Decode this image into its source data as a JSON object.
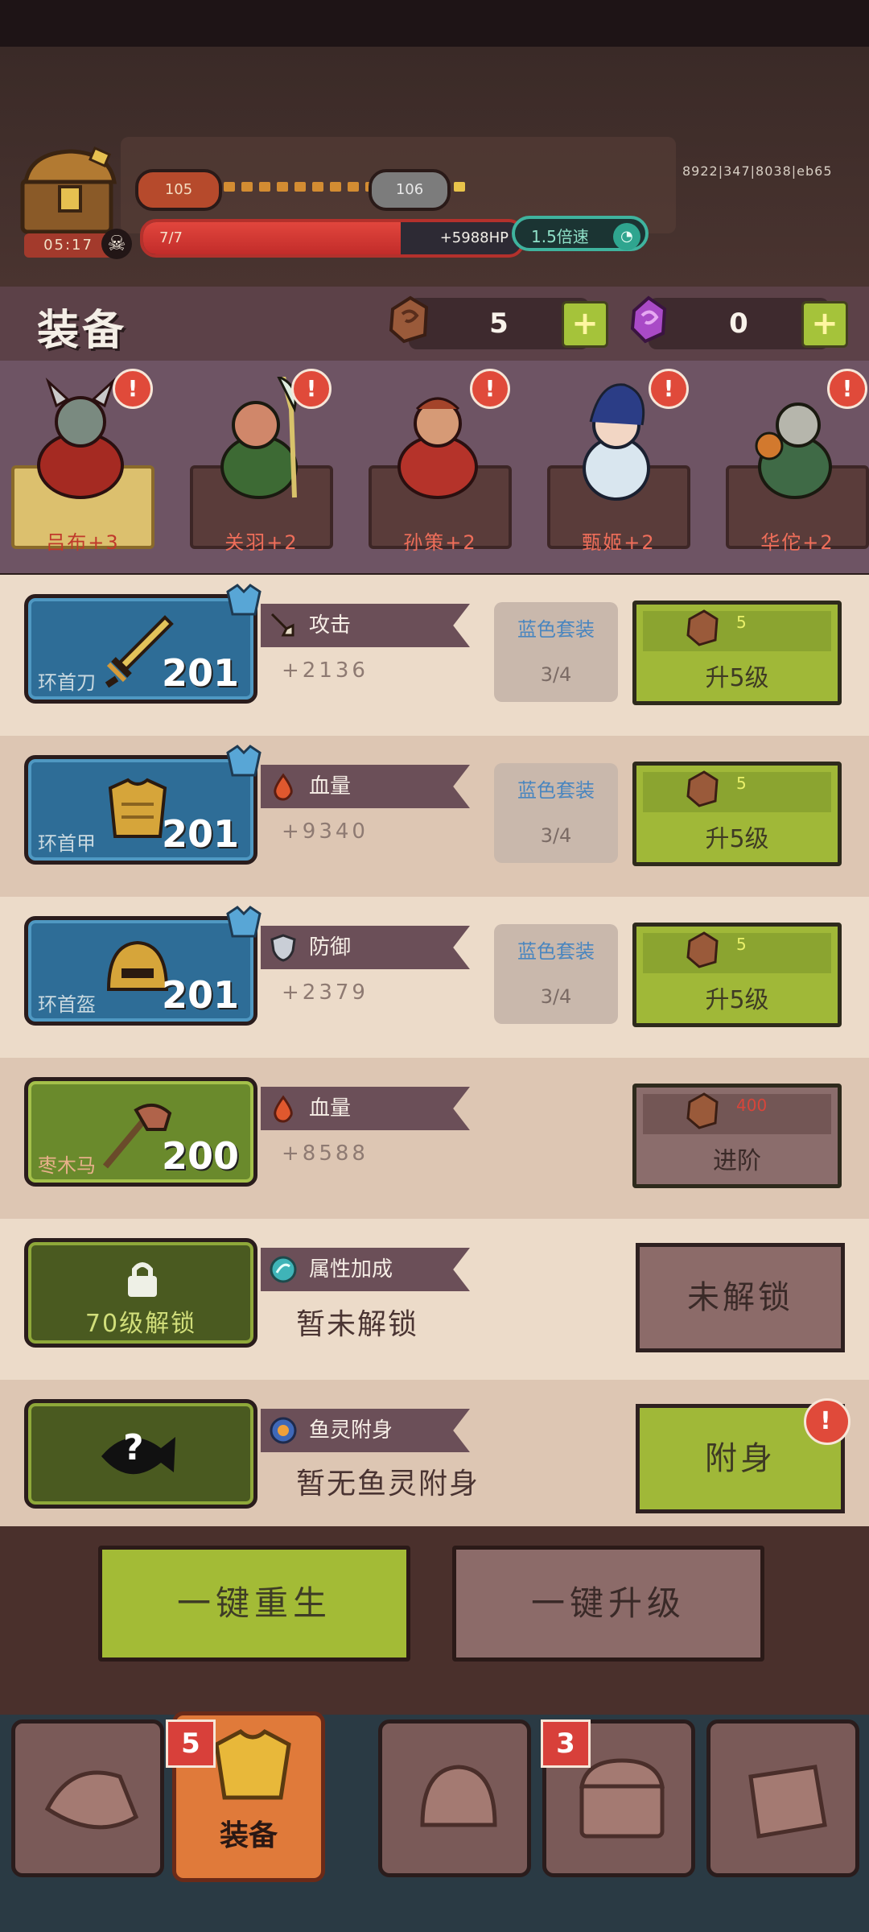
{
  "status": {
    "build": "8922|347|8038|eb65"
  },
  "chest": {
    "timer": "05:17"
  },
  "level": {
    "current": "105",
    "next": "106",
    "progress_dots": 14,
    "progress_on": 1
  },
  "hp": {
    "label": "7/7",
    "value": "+5988HP",
    "fill_fraction": 0.68
  },
  "speed": {
    "label": "1.5倍速"
  },
  "header": {
    "title": "装备",
    "currency1": {
      "value": "5",
      "plus": "+"
    },
    "currency2": {
      "value": "0",
      "plus": "+"
    }
  },
  "heroes": [
    {
      "name": "吕布+3",
      "selected": true,
      "alert": "!"
    },
    {
      "name": "关羽+2",
      "selected": false,
      "alert": "!"
    },
    {
      "name": "孙策+2",
      "selected": false,
      "alert": "!"
    },
    {
      "name": "甄姬+2",
      "selected": false,
      "alert": "!"
    },
    {
      "name": "华佗+2",
      "selected": false,
      "alert": "!"
    }
  ],
  "equipment": [
    {
      "item": "环首刀",
      "level": "201",
      "stat": "攻击",
      "value": "+2136",
      "set_name": "蓝色套装",
      "set_count": "3/4",
      "cost": "5",
      "action": "升5级"
    },
    {
      "item": "环首甲",
      "level": "201",
      "stat": "血量",
      "value": "+9340",
      "set_name": "蓝色套装",
      "set_count": "3/4",
      "cost": "5",
      "action": "升5级"
    },
    {
      "item": "环首盔",
      "level": "201",
      "stat": "防御",
      "value": "+2379",
      "set_name": "蓝色套装",
      "set_count": "3/4",
      "cost": "5",
      "action": "升5级"
    },
    {
      "item": "枣木马",
      "level": "200",
      "stat": "血量",
      "value": "+8588",
      "cost": "400",
      "action": "进阶"
    }
  ],
  "attribute": {
    "lock_text": "70级解锁",
    "stat": "属性加成",
    "status": "暂未解锁",
    "button": "未解锁"
  },
  "fish": {
    "mystery": "?",
    "stat": "鱼灵附身",
    "status": "暂无鱼灵附身",
    "button": "附身",
    "alert": "!"
  },
  "actions": {
    "rebirth": "一键重生",
    "upgrade_all": "一键升级"
  },
  "nav": {
    "tab2_label": "装备",
    "tab2_badge": "5",
    "tab4_badge": "3"
  },
  "colors": {
    "accent_green": "#a3bb36",
    "hp_red": "#c22c2a",
    "blue_slot": "#2e6d97"
  }
}
